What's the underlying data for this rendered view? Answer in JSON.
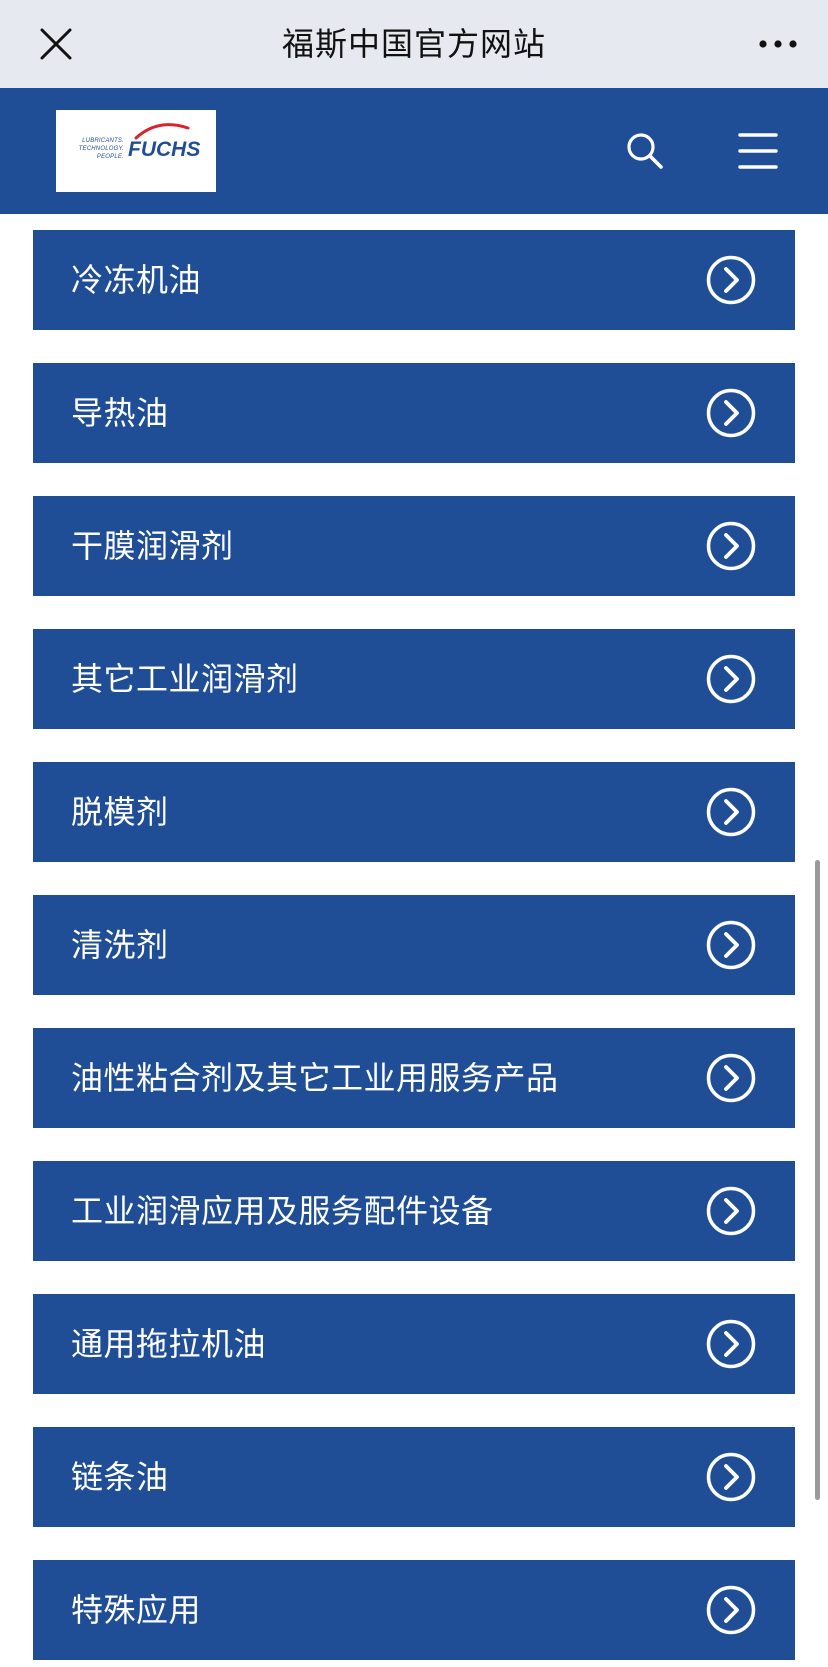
{
  "window": {
    "title": "福斯中国官方网站"
  },
  "header": {
    "logo": {
      "tagline": "LUBRICANTS.\nTECHNOLOGY.\nPEOPLE.",
      "wordmark": "FUCHS"
    }
  },
  "menu_items": [
    {
      "label": "冷冻机油"
    },
    {
      "label": "导热油"
    },
    {
      "label": "干膜润滑剂"
    },
    {
      "label": "其它工业润滑剂"
    },
    {
      "label": "脱模剂"
    },
    {
      "label": "清洗剂"
    },
    {
      "label": "油性粘合剂及其它工业用服务产品"
    },
    {
      "label": "工业润滑应用及服务配件设备"
    },
    {
      "label": "通用拖拉机油"
    },
    {
      "label": "链条油"
    },
    {
      "label": "特殊应用"
    }
  ],
  "icons": {
    "close": "close-icon",
    "more": "more-dots-icon",
    "search": "search-icon",
    "menu": "hamburger-menu-icon",
    "item_arrow": "chevron-right-circle-icon"
  },
  "colors": {
    "brand_blue": "#1f4e96",
    "topbar_bg": "#e6e9ef",
    "item_text": "#ffffff"
  }
}
